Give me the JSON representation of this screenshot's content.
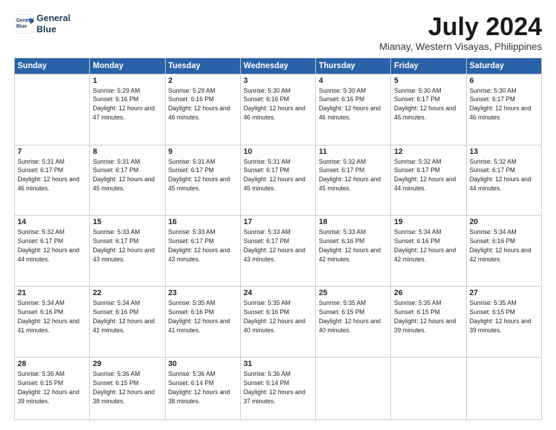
{
  "logo": {
    "line1": "General",
    "line2": "Blue"
  },
  "title": "July 2024",
  "subtitle": "Mianay, Western Visayas, Philippines",
  "weekdays": [
    "Sunday",
    "Monday",
    "Tuesday",
    "Wednesday",
    "Thursday",
    "Friday",
    "Saturday"
  ],
  "weeks": [
    [
      {
        "day": "",
        "info": ""
      },
      {
        "day": "1",
        "info": "Sunrise: 5:29 AM\nSunset: 6:16 PM\nDaylight: 12 hours\nand 47 minutes."
      },
      {
        "day": "2",
        "info": "Sunrise: 5:29 AM\nSunset: 6:16 PM\nDaylight: 12 hours\nand 46 minutes."
      },
      {
        "day": "3",
        "info": "Sunrise: 5:30 AM\nSunset: 6:16 PM\nDaylight: 12 hours\nand 46 minutes."
      },
      {
        "day": "4",
        "info": "Sunrise: 5:30 AM\nSunset: 6:16 PM\nDaylight: 12 hours\nand 46 minutes."
      },
      {
        "day": "5",
        "info": "Sunrise: 5:30 AM\nSunset: 6:17 PM\nDaylight: 12 hours\nand 46 minutes."
      },
      {
        "day": "6",
        "info": "Sunrise: 5:30 AM\nSunset: 6:17 PM\nDaylight: 12 hours\nand 46 minutes."
      }
    ],
    [
      {
        "day": "7",
        "info": "Sunrise: 5:31 AM\nSunset: 6:17 PM\nDaylight: 12 hours\nand 46 minutes."
      },
      {
        "day": "8",
        "info": "Sunrise: 5:31 AM\nSunset: 6:17 PM\nDaylight: 12 hours\nand 45 minutes."
      },
      {
        "day": "9",
        "info": "Sunrise: 5:31 AM\nSunset: 6:17 PM\nDaylight: 12 hours\nand 45 minutes."
      },
      {
        "day": "10",
        "info": "Sunrise: 5:31 AM\nSunset: 6:17 PM\nDaylight: 12 hours\nand 45 minutes."
      },
      {
        "day": "11",
        "info": "Sunrise: 5:32 AM\nSunset: 6:17 PM\nDaylight: 12 hours\nand 45 minutes."
      },
      {
        "day": "12",
        "info": "Sunrise: 5:32 AM\nSunset: 6:17 PM\nDaylight: 12 hours\nand 44 minutes."
      },
      {
        "day": "13",
        "info": "Sunrise: 5:32 AM\nSunset: 6:17 PM\nDaylight: 12 hours\nand 44 minutes."
      }
    ],
    [
      {
        "day": "14",
        "info": "Sunrise: 5:32 AM\nSunset: 6:17 PM\nDaylight: 12 hours\nand 44 minutes."
      },
      {
        "day": "15",
        "info": "Sunrise: 5:33 AM\nSunset: 6:17 PM\nDaylight: 12 hours\nand 43 minutes."
      },
      {
        "day": "16",
        "info": "Sunrise: 5:33 AM\nSunset: 6:17 PM\nDaylight: 12 hours\nand 43 minutes."
      },
      {
        "day": "17",
        "info": "Sunrise: 5:33 AM\nSunset: 6:17 PM\nDaylight: 12 hours\nand 43 minutes."
      },
      {
        "day": "18",
        "info": "Sunrise: 5:33 AM\nSunset: 6:16 PM\nDaylight: 12 hours\nand 42 minutes."
      },
      {
        "day": "19",
        "info": "Sunrise: 5:34 AM\nSunset: 6:16 PM\nDaylight: 12 hours\nand 42 minutes."
      },
      {
        "day": "20",
        "info": "Sunrise: 5:34 AM\nSunset: 6:16 PM\nDaylight: 12 hours\nand 42 minutes."
      }
    ],
    [
      {
        "day": "21",
        "info": "Sunrise: 5:34 AM\nSunset: 6:16 PM\nDaylight: 12 hours\nand 41 minutes."
      },
      {
        "day": "22",
        "info": "Sunrise: 5:34 AM\nSunset: 6:16 PM\nDaylight: 12 hours\nand 41 minutes."
      },
      {
        "day": "23",
        "info": "Sunrise: 5:35 AM\nSunset: 6:16 PM\nDaylight: 12 hours\nand 41 minutes."
      },
      {
        "day": "24",
        "info": "Sunrise: 5:35 AM\nSunset: 6:16 PM\nDaylight: 12 hours\nand 40 minutes."
      },
      {
        "day": "25",
        "info": "Sunrise: 5:35 AM\nSunset: 6:15 PM\nDaylight: 12 hours\nand 40 minutes."
      },
      {
        "day": "26",
        "info": "Sunrise: 5:35 AM\nSunset: 6:15 PM\nDaylight: 12 hours\nand 39 minutes."
      },
      {
        "day": "27",
        "info": "Sunrise: 5:35 AM\nSunset: 6:15 PM\nDaylight: 12 hours\nand 39 minutes."
      }
    ],
    [
      {
        "day": "28",
        "info": "Sunrise: 5:36 AM\nSunset: 6:15 PM\nDaylight: 12 hours\nand 39 minutes."
      },
      {
        "day": "29",
        "info": "Sunrise: 5:36 AM\nSunset: 6:15 PM\nDaylight: 12 hours\nand 38 minutes."
      },
      {
        "day": "30",
        "info": "Sunrise: 5:36 AM\nSunset: 6:14 PM\nDaylight: 12 hours\nand 38 minutes."
      },
      {
        "day": "31",
        "info": "Sunrise: 5:36 AM\nSunset: 6:14 PM\nDaylight: 12 hours\nand 37 minutes."
      },
      {
        "day": "",
        "info": ""
      },
      {
        "day": "",
        "info": ""
      },
      {
        "day": "",
        "info": ""
      }
    ]
  ]
}
